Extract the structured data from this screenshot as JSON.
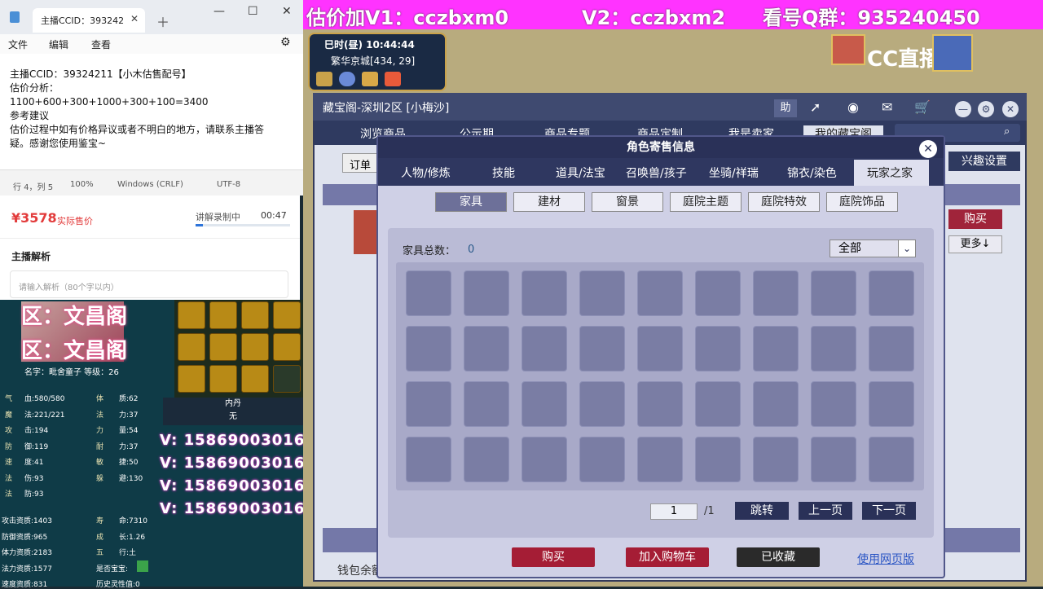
{
  "notepad": {
    "tab_title": "主播CCID：393242",
    "menu": [
      "文件",
      "编辑",
      "查看"
    ],
    "lines": [
      "主播CCID：39324211【小木估售配号】",
      "估价分析：",
      "1100+600+300+1000+300+100=3400",
      "参考建议",
      "估价过程中如有价格异议或者不明白的地方，请联系主播答",
      "疑。感谢您使用鉴宝~"
    ],
    "status": {
      "pos": "行 4，列 5",
      "zoom": "100%",
      "eol": "Windows (CRLF)",
      "enc": "UTF-8"
    }
  },
  "estimate": {
    "price": "¥3578",
    "price_label": "实际售价",
    "rec_label": "讲解录制中",
    "rec_time": "00:47",
    "rec_progress": 0.08,
    "analysis_title": "主播解析",
    "analysis_placeholder": "请输入解析（80个字以内）"
  },
  "character": {
    "zone1": "区：文昌阁",
    "zone2": "区：文昌阁",
    "name_line": "名字：毗舍童子  等级：26",
    "stats_left": [
      [
        "气",
        "血:580/580"
      ],
      [
        "魔",
        "法:221/221"
      ],
      [
        "攻",
        "击:194"
      ],
      [
        "防",
        "御:119"
      ],
      [
        "速",
        "度:41"
      ],
      [
        "法",
        "伤:93"
      ],
      [
        "法",
        "防:93"
      ]
    ],
    "stats_right": [
      [
        "体",
        "质:62"
      ],
      [
        "法",
        "力:37"
      ],
      [
        "力",
        "量:54"
      ],
      [
        "耐",
        "力:37"
      ],
      [
        "敏",
        "捷:50"
      ],
      [
        "躲",
        "避:130"
      ]
    ],
    "aptitudes": [
      [
        "攻击资质:1403",
        "寿",
        "命:7310"
      ],
      [
        "防御资质:965",
        "成",
        "长:1.26"
      ],
      [
        "体力资质:2183",
        "五",
        "行:土"
      ],
      [
        "法力资质:1577",
        "是否宝宝:",
        ""
      ],
      [
        "速度资质:831",
        "历史灵性值:0",
        ""
      ]
    ],
    "neidan_title": "内丹",
    "neidan_value": "无",
    "v_lines": [
      "V:  15869003016",
      "V:  15869003016",
      "V:  15869003016",
      "V:  15869003016"
    ]
  },
  "banner": {
    "v1": "估价加V1：cczbxm0",
    "v2": "V2：cczbxm2",
    "qq": "看号Q群：935240450",
    "cc": "CC直播"
  },
  "game": {
    "time_line": "巳时(昼)  10:44:44",
    "location": "繁华京城[434, 29]"
  },
  "main_window": {
    "title": "藏宝阁-深圳2区 [小梅沙]",
    "help": "助",
    "tabs": [
      "浏览商品",
      "公示期",
      "商品专题",
      "商品定制",
      "我是卖家",
      "我的藏宝阁"
    ],
    "order_btn": "订单",
    "interest_btn": "兴趣设置",
    "buy_btn": "购买",
    "more_btn": "更多↓",
    "wallet": "钱包余额"
  },
  "dialog": {
    "title": "角色寄售信息",
    "close": "✕",
    "tabs": [
      "人物/修炼",
      "技能",
      "道具/法宝",
      "召唤兽/孩子",
      "坐骑/祥瑞",
      "锦衣/染色",
      "玩家之家"
    ],
    "active_tab": "玩家之家",
    "subtabs": [
      "家具",
      "建材",
      "窗景",
      "庭院主题",
      "庭院特效",
      "庭院饰品"
    ],
    "total_label": "家具总数：",
    "total_value": "0",
    "filter": "全部",
    "page_current": "1",
    "page_total": "/1",
    "btn_jump": "跳转",
    "btn_prev": "上一页",
    "btn_next": "下一页",
    "btn_buy": "购买",
    "btn_cart": "加入购物车",
    "btn_fav": "已收藏",
    "web_version": "使用网页版",
    "colors": {
      "buy": "#a51d35",
      "cart": "#a51d35",
      "fav": "#2a2a2a"
    }
  }
}
